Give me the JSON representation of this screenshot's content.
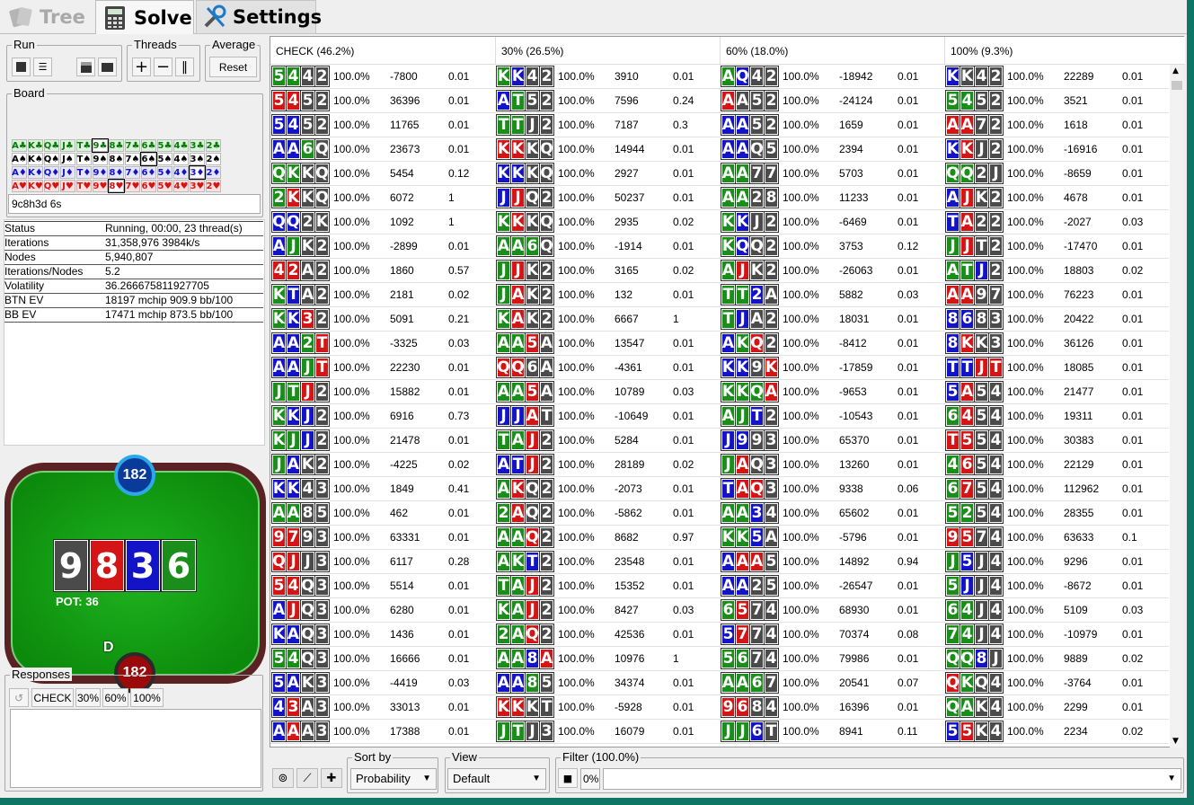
{
  "tabs": [
    {
      "label": "Tree",
      "icon": "cards-icon"
    },
    {
      "label": "Solve",
      "icon": "calculator-icon"
    },
    {
      "label": "Settings",
      "icon": "tools-icon"
    }
  ],
  "run": {
    "title": "Run"
  },
  "threads": {
    "title": "Threads"
  },
  "average": {
    "title": "Average",
    "reset": "Reset"
  },
  "board": {
    "title": "Board",
    "value": "9c8h3d 6s",
    "rows": [
      {
        "suit": "c",
        "cards": [
          "A♣",
          "K♣",
          "Q♣",
          "J♣",
          "T♣",
          "9♣",
          "8♣",
          "7♣",
          "6♣",
          "5♣",
          "4♣",
          "3♣",
          "2♣"
        ]
      },
      {
        "suit": "s",
        "cards": [
          "A♠",
          "K♠",
          "Q♠",
          "J♠",
          "T♠",
          "9♠",
          "8♠",
          "7♠",
          "6♠",
          "5♠",
          "4♠",
          "3♠",
          "2♠"
        ]
      },
      {
        "suit": "d",
        "cards": [
          "A♦",
          "K♦",
          "Q♦",
          "J♦",
          "T♦",
          "9♦",
          "8♦",
          "7♦",
          "6♦",
          "5♦",
          "4♦",
          "3♦",
          "2♦"
        ]
      },
      {
        "suit": "h",
        "cards": [
          "A♥",
          "K♥",
          "Q♥",
          "J♥",
          "T♥",
          "9♥",
          "8♥",
          "7♥",
          "6♥",
          "5♥",
          "4♥",
          "3♥",
          "2♥"
        ]
      }
    ]
  },
  "stats": [
    {
      "k": "Status",
      "v": "Running, 00:00, 23 thread(s)"
    },
    {
      "k": "Iterations",
      "v": "31,358,976  3984k/s"
    },
    {
      "k": "Nodes",
      "v": "5,940,807"
    },
    {
      "k": "Iterations/Nodes",
      "v": "5.2"
    },
    {
      "k": "Volatility",
      "v": "36.266675811927705"
    },
    {
      "k": "BTN EV",
      "v": "18197 mchip   909.9 bb/100"
    },
    {
      "k": "BB EV",
      "v": "17471 mchip   873.5 bb/100"
    }
  ],
  "table": {
    "top_stack": "182",
    "bottom_stack": "182",
    "dealer": "D",
    "pot": "POT: 36",
    "cards": [
      {
        "rank": "9",
        "suit": "c"
      },
      {
        "rank": "8",
        "suit": "h"
      },
      {
        "rank": "3",
        "suit": "d"
      },
      {
        "rank": "6",
        "suit": "s"
      }
    ]
  },
  "responses": {
    "title": "Responses",
    "buttons": [
      "CHECK",
      "30%",
      "60%",
      "100%"
    ]
  },
  "columns": [
    "CHECK (46.2%)",
    "30% (26.5%)",
    "60% (18.0%)",
    "100% (9.3%)"
  ],
  "suit_colors": {
    "s": "#1b8d1b",
    "h": "#d41515",
    "d": "#1313c8",
    "c": "#4b4b4b"
  },
  "rows": [
    [
      [
        "5s4s4c2c",
        "100.0%",
        "-7800",
        "0.01"
      ],
      [
        "KsKd4c2c",
        "100.0%",
        "3910",
        "0.01"
      ],
      [
        "AsQd4c2c",
        "100.0%",
        "-18942",
        "0.01"
      ],
      [
        "KdKc4c2c",
        "100.0%",
        "22289",
        "0.01"
      ]
    ],
    [
      [
        "5h4h5c2c",
        "100.0%",
        "36396",
        "0.01"
      ],
      [
        "AdTs5c2c",
        "100.0%",
        "7596",
        "0.24"
      ],
      [
        "AhAc5c2c",
        "100.0%",
        "-24124",
        "0.01"
      ],
      [
        "5s4s5c2c",
        "100.0%",
        "3521",
        "0.01"
      ]
    ],
    [
      [
        "5d4d5c2c",
        "100.0%",
        "11765",
        "0.01"
      ],
      [
        "TsTsJc2c",
        "100.0%",
        "7187",
        "0.3"
      ],
      [
        "AdAd5c2c",
        "100.0%",
        "1659",
        "0.01"
      ],
      [
        "AhAh7c2c",
        "100.0%",
        "1618",
        "0.01"
      ]
    ],
    [
      [
        "AdAd6sQc",
        "100.0%",
        "23673",
        "0.01"
      ],
      [
        "KhKhKcQc",
        "100.0%",
        "14944",
        "0.01"
      ],
      [
        "AdAdQc5c",
        "100.0%",
        "2394",
        "0.01"
      ],
      [
        "KdKhJc2c",
        "100.0%",
        "-16916",
        "0.01"
      ]
    ],
    [
      [
        "QsKsKcQc",
        "100.0%",
        "5454",
        "0.12"
      ],
      [
        "KdKdKcQc",
        "100.0%",
        "2927",
        "0.01"
      ],
      [
        "AsAs7c7c",
        "100.0%",
        "5703",
        "0.01"
      ],
      [
        "QsQs2cJc",
        "100.0%",
        "-8659",
        "0.01"
      ]
    ],
    [
      [
        "2sKhKcQc",
        "100.0%",
        "6072",
        "1"
      ],
      [
        "JdJhQc2c",
        "100.0%",
        "50237",
        "0.01"
      ],
      [
        "AsAs2c8c",
        "100.0%",
        "11233",
        "0.01"
      ],
      [
        "AdJhKc2c",
        "100.0%",
        "4678",
        "0.01"
      ]
    ],
    [
      [
        "QdQd2cKc",
        "100.0%",
        "1092",
        "1"
      ],
      [
        "KsKhKcQc",
        "100.0%",
        "2935",
        "0.02"
      ],
      [
        "KsKdJc2c",
        "100.0%",
        "-6469",
        "0.01"
      ],
      [
        "TdAh2c2c",
        "100.0%",
        "-2027",
        "0.03"
      ]
    ],
    [
      [
        "AdJsKc2c",
        "100.0%",
        "-2899",
        "0.01"
      ],
      [
        "AsAs6sQc",
        "100.0%",
        "-1914",
        "0.01"
      ],
      [
        "KsQdQc2c",
        "100.0%",
        "3753",
        "0.12"
      ],
      [
        "JsJhTc2c",
        "100.0%",
        "-17470",
        "0.01"
      ]
    ],
    [
      [
        "4h2hAc2c",
        "100.0%",
        "1860",
        "0.57"
      ],
      [
        "JsJhKc2c",
        "100.0%",
        "3165",
        "0.02"
      ],
      [
        "AsJhKc2c",
        "100.0%",
        "-26063",
        "0.01"
      ],
      [
        "AsTsJd2c",
        "100.0%",
        "18803",
        "0.02"
      ]
    ],
    [
      [
        "KsTdAc2c",
        "100.0%",
        "2181",
        "0.02"
      ],
      [
        "JsAhKc2c",
        "100.0%",
        "132",
        "0.01"
      ],
      [
        "TsTs2dAc2c",
        "100.0%",
        "5882",
        "0.03"
      ],
      [
        "AhAh9c7c",
        "100.0%",
        "76223",
        "0.01"
      ]
    ],
    [
      [
        "KsKd3h2c",
        "100.0%",
        "5091",
        "0.21"
      ],
      [
        "KsAhKc2c",
        "100.0%",
        "6667",
        "1"
      ],
      [
        "TsJdAc2c",
        "100.0%",
        "18031",
        "0.01"
      ],
      [
        "8d6d8c3c",
        "100.0%",
        "20422",
        "0.01"
      ]
    ],
    [
      [
        "AdAd2sTh",
        "100.0%",
        "-3325",
        "0.03"
      ],
      [
        "AsAs5hAc",
        "100.0%",
        "13547",
        "0.01"
      ],
      [
        "AdKsQh2c",
        "100.0%",
        "-8412",
        "0.01"
      ],
      [
        "8dKhKc3c",
        "100.0%",
        "36126",
        "0.01"
      ]
    ],
    [
      [
        "AdAdJsTh",
        "100.0%",
        "22230",
        "0.01"
      ],
      [
        "QhQh6cAc",
        "100.0%",
        "-4361",
        "0.01"
      ],
      [
        "KdKd9cKh",
        "100.0%",
        "-17859",
        "0.01"
      ],
      [
        "TdTdJhTh",
        "100.0%",
        "18085",
        "0.01"
      ]
    ],
    [
      [
        "JsTsJh2c",
        "100.0%",
        "15882",
        "0.01"
      ],
      [
        "AsAs5hAc",
        "100.0%",
        "10789",
        "0.03"
      ],
      [
        "KsKsQsAh",
        "100.0%",
        "-9653",
        "0.01"
      ],
      [
        "5dAh5c4c",
        "100.0%",
        "21477",
        "0.01"
      ]
    ],
    [
      [
        "KsKdJd2c",
        "100.0%",
        "6916",
        "0.73"
      ],
      [
        "JdJdAhTc",
        "100.0%",
        "-10649",
        "0.01"
      ],
      [
        "AsJsTd2c",
        "100.0%",
        "-10543",
        "0.01"
      ],
      [
        "6s4h5c4c",
        "100.0%",
        "19311",
        "0.01"
      ]
    ],
    [
      [
        "KsJsJd2c",
        "100.0%",
        "21478",
        "0.01"
      ],
      [
        "TsAsJh2c",
        "100.0%",
        "5284",
        "0.01"
      ],
      [
        "Jd9d9c3c",
        "100.0%",
        "65370",
        "0.01"
      ],
      [
        "Th5h5c4c",
        "100.0%",
        "30383",
        "0.01"
      ]
    ],
    [
      [
        "JsAdKc2c",
        "100.0%",
        "-4225",
        "0.02"
      ],
      [
        "AdTdJh2c",
        "100.0%",
        "28189",
        "0.02"
      ],
      [
        "JsAhQc3c",
        "100.0%",
        "13260",
        "0.01"
      ],
      [
        "4s6h5c4c",
        "100.0%",
        "22129",
        "0.01"
      ]
    ],
    [
      [
        "KdKd4c3c",
        "100.0%",
        "1849",
        "0.41"
      ],
      [
        "AsKhQc2c",
        "100.0%",
        "-2073",
        "0.01"
      ],
      [
        "TdAhQh3c",
        "100.0%",
        "9338",
        "0.06"
      ],
      [
        "6s7h5c4c",
        "100.0%",
        "112962",
        "0.01"
      ]
    ],
    [
      [
        "AsAs8c5c3c",
        "100.0%",
        "462",
        "0.01"
      ],
      [
        "2sAhQc2c",
        "100.0%",
        "-5862",
        "0.01"
      ],
      [
        "AsAs3d4c3c",
        "100.0%",
        "65602",
        "0.01"
      ],
      [
        "5s2s5c4c",
        "100.0%",
        "28355",
        "0.01"
      ]
    ],
    [
      [
        "9h7h9c3c",
        "100.0%",
        "63331",
        "0.01"
      ],
      [
        "AsAsQh2c",
        "100.0%",
        "8682",
        "0.97"
      ],
      [
        "KsKs5dAc3c",
        "100.0%",
        "-5796",
        "0.01"
      ],
      [
        "9h5h7c4c",
        "100.0%",
        "63633",
        "0.1"
      ]
    ],
    [
      [
        "QhJhJc3c",
        "100.0%",
        "6117",
        "0.28"
      ],
      [
        "AsKsTd2c",
        "100.0%",
        "23548",
        "0.01"
      ],
      [
        "AdAhAh5c4c",
        "100.0%",
        "14892",
        "0.94"
      ],
      [
        "Js5dJc4c",
        "100.0%",
        "9296",
        "0.01"
      ]
    ],
    [
      [
        "5h4hQc3c",
        "100.0%",
        "5514",
        "0.01"
      ],
      [
        "TsAsJh2c",
        "100.0%",
        "15352",
        "0.01"
      ],
      [
        "AdAd2c5c4c",
        "100.0%",
        "-26547",
        "0.01"
      ],
      [
        "5sJdJc4c",
        "100.0%",
        "-8672",
        "0.01"
      ]
    ],
    [
      [
        "AdJhQc3c",
        "100.0%",
        "6280",
        "0.01"
      ],
      [
        "KsAsJh2c",
        "100.0%",
        "8427",
        "0.03"
      ],
      [
        "6s5h7c4c",
        "100.0%",
        "68930",
        "0.01"
      ],
      [
        "6s4sJc4c",
        "100.0%",
        "5109",
        "0.03"
      ]
    ],
    [
      [
        "KdAdQc3c",
        "100.0%",
        "1436",
        "0.01"
      ],
      [
        "2sAsQh2c",
        "100.0%",
        "42536",
        "0.01"
      ],
      [
        "5d7h7c4c",
        "100.0%",
        "70374",
        "0.08"
      ],
      [
        "7s4sJc4c",
        "100.0%",
        "-10979",
        "0.01"
      ]
    ],
    [
      [
        "5s4sQc3c",
        "100.0%",
        "16666",
        "0.01"
      ],
      [
        "AsAs8dAh2c",
        "100.0%",
        "10976",
        "1"
      ],
      [
        "5s6s7c4c",
        "100.0%",
        "79986",
        "0.01"
      ],
      [
        "QsQs8dJc4c",
        "100.0%",
        "9889",
        "0.02"
      ]
    ],
    [
      [
        "5dAdKc3c",
        "100.0%",
        "-4419",
        "0.03"
      ],
      [
        "AdAd8s5c3c",
        "100.0%",
        "34374",
        "0.01"
      ],
      [
        "AsAs6s7c4c",
        "100.0%",
        "20541",
        "0.07"
      ],
      [
        "QhKsQc4c",
        "100.0%",
        "-3764",
        "0.01"
      ]
    ],
    [
      [
        "4d3hAc3c",
        "100.0%",
        "33013",
        "0.01"
      ],
      [
        "KhKhKcTc3c",
        "100.0%",
        "-5928",
        "0.01"
      ],
      [
        "9h6h8c4c",
        "100.0%",
        "16396",
        "0.01"
      ],
      [
        "QsAsKc4c",
        "100.0%",
        "2299",
        "0.01"
      ]
    ],
    [
      [
        "AdAhAc3c",
        "100.0%",
        "17388",
        "0.01"
      ],
      [
        "JsTsJc3c",
        "100.0%",
        "16079",
        "0.01"
      ],
      [
        "JsJs6dTc4c",
        "100.0%",
        "8941",
        "0.11"
      ],
      [
        "5d5hKc4c",
        "100.0%",
        "2234",
        "0.02"
      ]
    ]
  ],
  "bottom": {
    "sort_label": "Sort by",
    "sort_value": "Probability",
    "view_label": "View",
    "view_value": "Default",
    "filter_label": "Filter (100.0%)",
    "filter_pct": "0%"
  }
}
